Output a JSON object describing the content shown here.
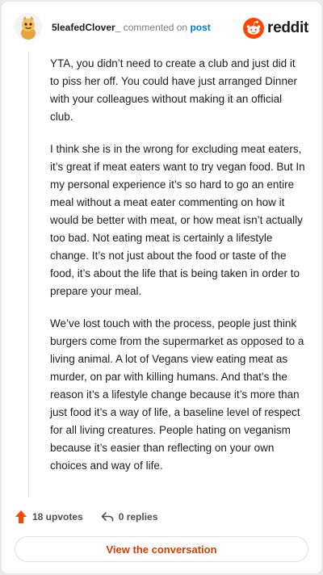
{
  "comment": {
    "username": "5leafedClover_",
    "action_text": " commented on ",
    "post_link": "post",
    "paragraphs": [
      "YTA, you didn’t need to create a club and just did it to piss her off. You could have just arranged Dinner with your colleagues without making it an official club.",
      "I think she is in the wrong for excluding meat eaters, it’s great if meat eaters want to try vegan food. But In my personal experience it’s so hard to go an entire meal without a meat eater commenting on how it would be better with meat, or how meat isn’t actually too bad. Not eating meat is certainly a lifestyle change. It’s not just about the food or taste of the food, it’s about the life that is being taken in order to prepare your meal.",
      "We’ve lost touch with the process, people just think burgers come from the supermarket as opposed to a living animal. A lot of Vegans view eating meat as murder, on par with killing humans. And that’s the reason it’s a lifestyle change because it’s more than just food it’s a way of life, a baseline level of respect for all living creatures. People hating on veganism because it’s easier than reflecting on your own choices and way of life."
    ]
  },
  "brand": {
    "name": "reddit",
    "color": "#ff4500"
  },
  "footer": {
    "upvotes": "18 upvotes",
    "replies": "0 replies"
  },
  "cta": {
    "label": "View the conversation",
    "color": "#d93a00"
  },
  "icons": {
    "avatar": "snoo-avatar-icon",
    "brand": "reddit-logo-icon",
    "upvote": "upvote-arrow-icon",
    "reply": "reply-arrow-icon"
  }
}
